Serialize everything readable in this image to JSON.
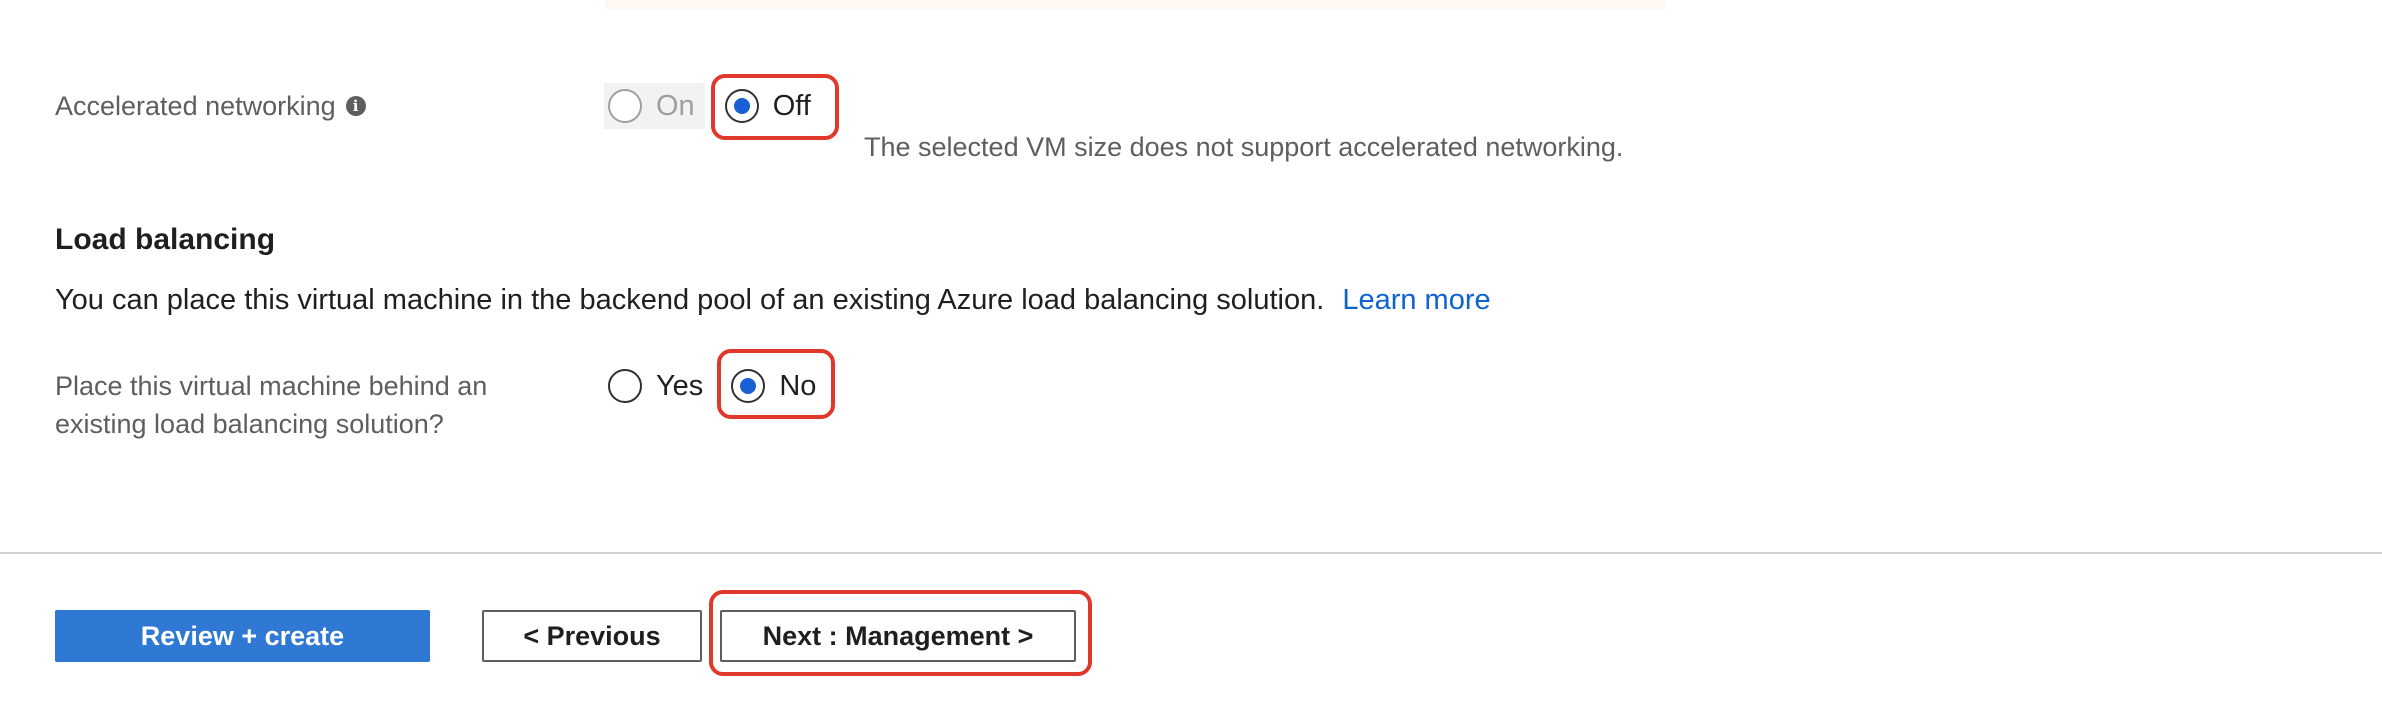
{
  "accelerated_networking": {
    "label": "Accelerated networking",
    "info_icon": "info-icon",
    "options": [
      {
        "label": "On",
        "selected": false,
        "disabled": true
      },
      {
        "label": "Off",
        "selected": true,
        "disabled": false
      }
    ],
    "note": "The selected VM size does not support accelerated networking."
  },
  "load_balancing": {
    "heading": "Load balancing",
    "description": "You can place this virtual machine in the backend pool of an existing Azure load balancing solution.",
    "learn_more": "Learn more",
    "question_line1": "Place this virtual machine behind an",
    "question_line2": "existing load balancing solution?",
    "options": [
      {
        "label": "Yes",
        "selected": false
      },
      {
        "label": "No",
        "selected": true
      }
    ]
  },
  "footer": {
    "review_create": "Review + create",
    "previous": "< Previous",
    "next": "Next : Management >"
  },
  "colors": {
    "primary": "#2f78d4",
    "radio_selected": "#1a5fd6",
    "highlight": "#e0392b",
    "link": "#0f62d0"
  }
}
